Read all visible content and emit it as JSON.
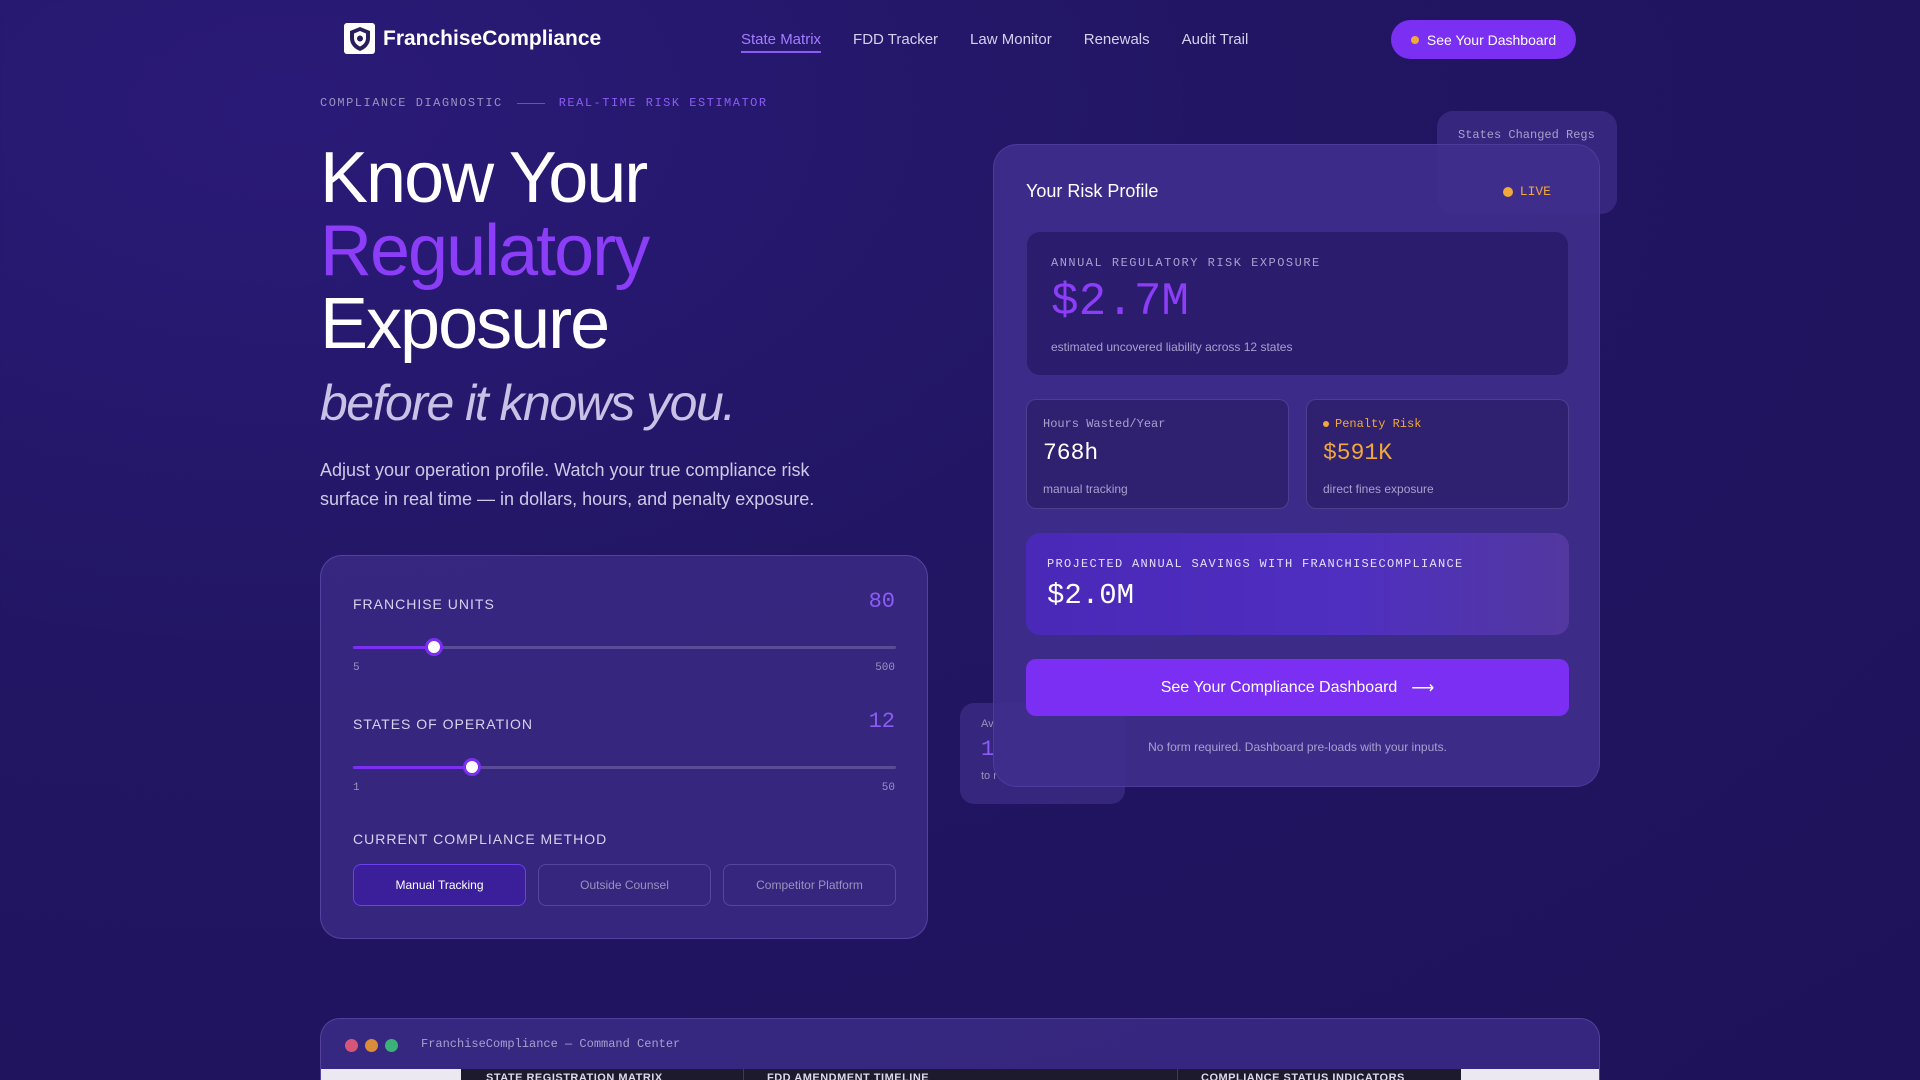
{
  "nav": {
    "logo_text": "FranchiseCompliance",
    "links": [
      "State Matrix",
      "FDD Tracker",
      "Law Monitor",
      "Renewals",
      "Audit Trail"
    ],
    "active_index": 0,
    "cta_label": "See Your Dashboard"
  },
  "hero": {
    "eyebrow_left": "COMPLIANCE DIAGNOSTIC",
    "eyebrow_right": "REAL-TIME RISK ESTIMATOR",
    "title_line1": "Know Your",
    "title_line2": "Regulatory",
    "title_line3": "Exposure",
    "subtitle": "before it knows you.",
    "description": "Adjust your operation profile. Watch your true compliance risk surface in real time — in dollars, hours, and penalty exposure."
  },
  "controls": {
    "units": {
      "label": "FRANCHISE UNITS",
      "value": "80",
      "min": "5",
      "max": "500",
      "fraction": 0.15
    },
    "states": {
      "label": "STATES OF OPERATION",
      "value": "12",
      "min": "1",
      "max": "50",
      "fraction": 0.22
    },
    "method_label": "CURRENT COMPLIANCE METHOD",
    "methods": [
      "Manual Tracking",
      "Outside Counsel",
      "Competitor Platform"
    ],
    "active_method": 0
  },
  "background_cards": {
    "states_changed_label": "States Changed Regs",
    "avg_label": "Av",
    "avg_value": "1",
    "avg_note": "to r"
  },
  "risk": {
    "title": "Your Risk Profile",
    "live_label": "LIVE",
    "exposure_label": "ANNUAL REGULATORY RISK EXPOSURE",
    "exposure_value": "$2.7M",
    "exposure_note": "estimated uncovered liability across 12 states",
    "hours_label": "Hours Wasted/Year",
    "hours_value": "768h",
    "hours_note": "manual tracking",
    "penalty_label": "Penalty Risk",
    "penalty_value": "$591K",
    "penalty_note": "direct fines exposure",
    "savings_label": "PROJECTED ANNUAL SAVINGS WITH FRANCHISECOMPLIANCE",
    "savings_value": "$2.0M",
    "cta_label": "See Your Compliance Dashboard",
    "cta_arrow": "⟶",
    "footnote": "No form required. Dashboard pre-loads with your inputs."
  },
  "command_center": {
    "title": "FranchiseCompliance — Command Center",
    "columns": [
      "STATE REGISTRATION MATRIX",
      "FDD AMENDMENT TIMELINE",
      "COMPLIANCE STATUS INDICATORS"
    ]
  },
  "colors": {
    "accent": "#8b3df7",
    "cta": "#7a2ff2",
    "amber": "#f0a93a",
    "background": "#221664"
  }
}
